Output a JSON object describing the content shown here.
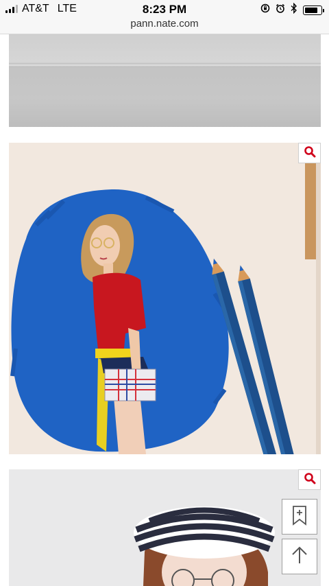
{
  "status_bar": {
    "carrier": "AT&T",
    "network": "LTE",
    "time": "8:23 PM",
    "icons": [
      "rotation-lock-icon",
      "alarm-icon",
      "bluetooth-icon",
      "battery-icon"
    ]
  },
  "browser": {
    "url": "pann.nate.com"
  },
  "images": [
    {
      "alt": "paper sheet photo"
    },
    {
      "alt": "colored pencil drawing of girl in red shirt with blue pencils"
    },
    {
      "alt": "drawing of woman in striped beret with glasses"
    }
  ],
  "icons": {
    "zoom": "zoom-icon",
    "bookmark": "bookmark-add-icon",
    "scroll_top": "arrow-up-icon"
  },
  "colors": {
    "zoom_icon": "#d0021b",
    "drawing_blue": "#1f63c4",
    "shirt_red": "#c8171f"
  }
}
